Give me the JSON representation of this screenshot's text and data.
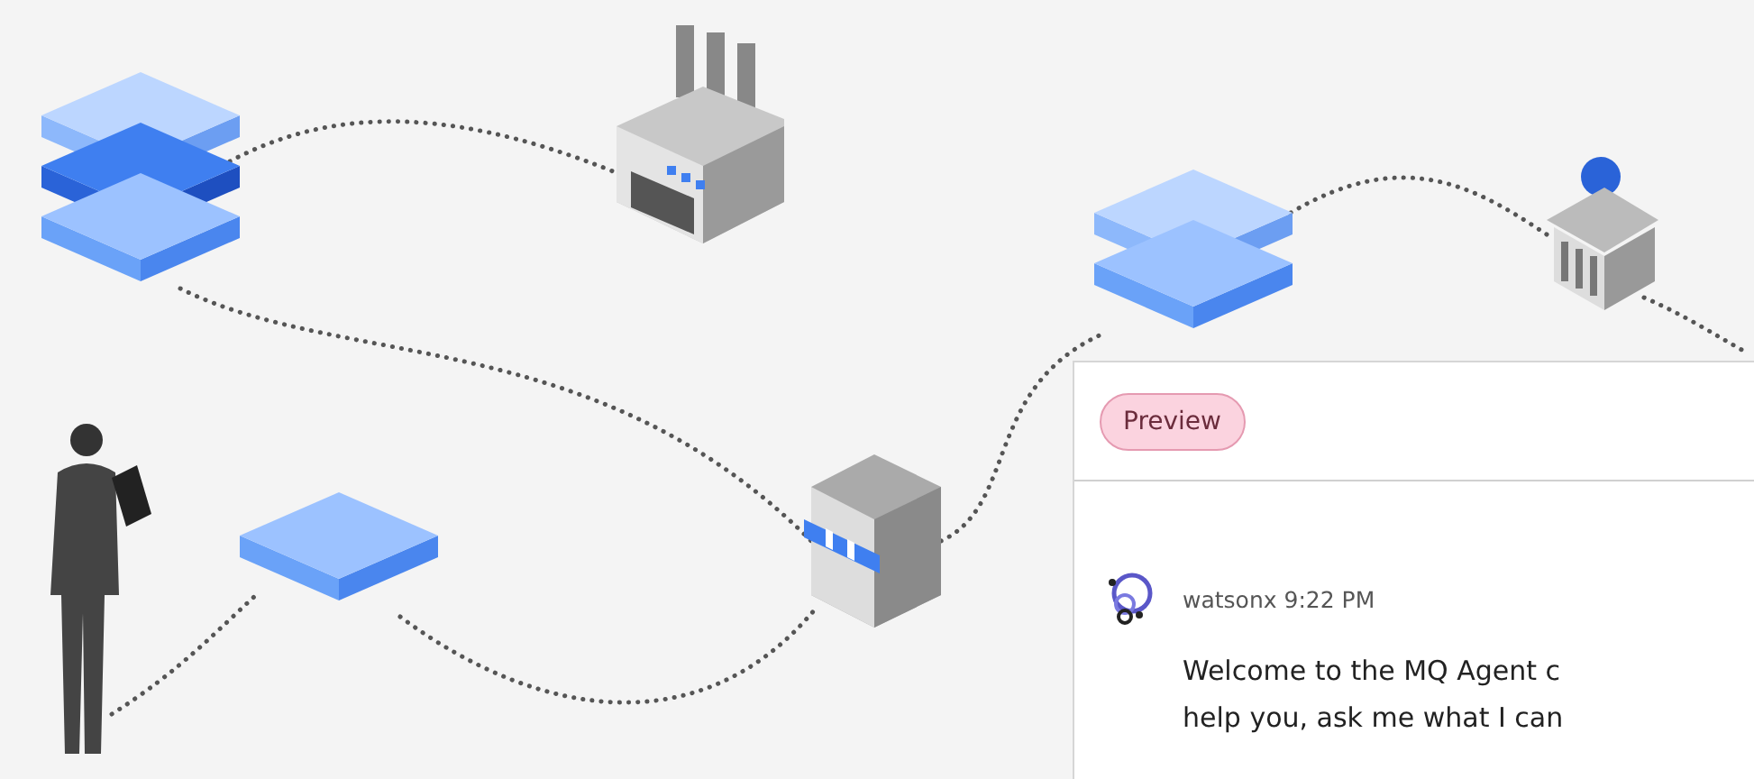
{
  "chat_panel": {
    "badge": "Preview",
    "messages": [
      {
        "sender": "watsonx",
        "time": "9:22 PM",
        "text": "Welcome to the MQ Agent c\nhelp you, ask me what I can"
      }
    ]
  }
}
